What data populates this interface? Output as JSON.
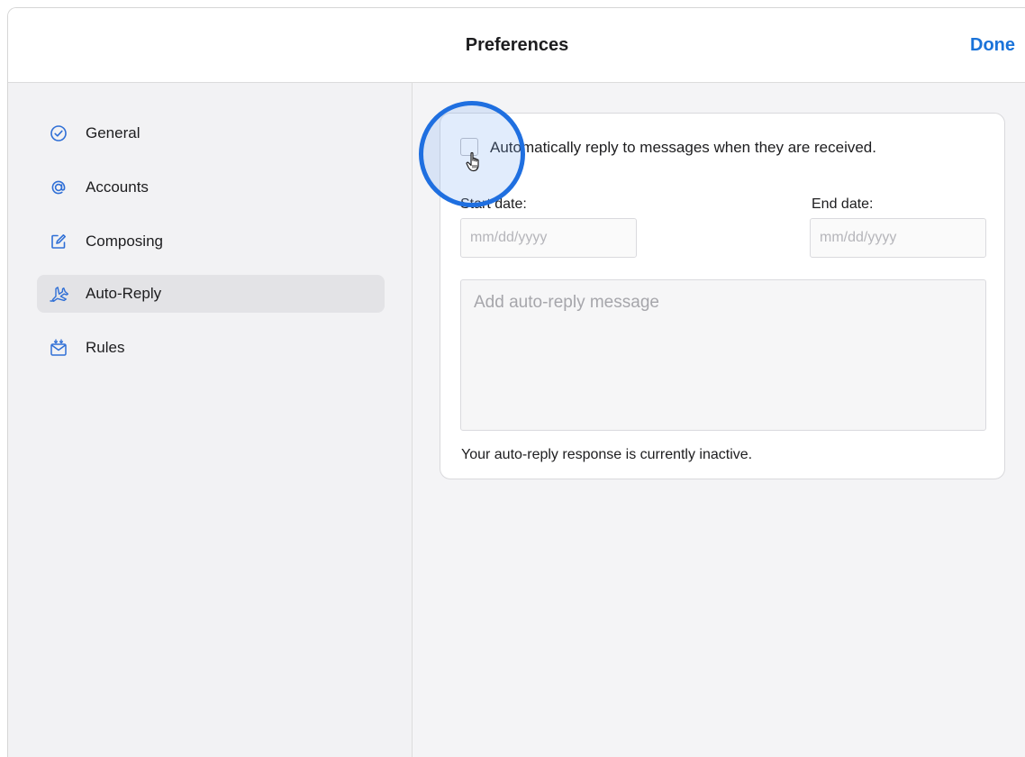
{
  "header": {
    "title": "Preferences",
    "done_label": "Done",
    "accent_color": "#1a73d9"
  },
  "sidebar": {
    "items": [
      {
        "label": "General",
        "icon": "checkmark-circle-icon",
        "active": false
      },
      {
        "label": "Accounts",
        "icon": "at-sign-icon",
        "active": false
      },
      {
        "label": "Composing",
        "icon": "compose-icon",
        "active": false
      },
      {
        "label": "Auto-Reply",
        "icon": "airplane-icon",
        "active": true
      },
      {
        "label": "Rules",
        "icon": "mail-rules-icon",
        "active": false
      }
    ]
  },
  "auto_reply": {
    "checkbox_label": "Automatically reply to messages when they are received.",
    "checkbox_checked": false,
    "start_date_label": "Start date:",
    "start_date_placeholder": "mm/dd/yyyy",
    "start_date_value": "",
    "end_date_label": "End date:",
    "end_date_placeholder": "mm/dd/yyyy",
    "end_date_value": "",
    "message_placeholder": "Add auto-reply message",
    "message_value": "",
    "status_text": "Your auto-reply response is currently inactive."
  },
  "colors": {
    "focus_ring": "#1f6fe0",
    "sidebar_icon": "#2f6fd6"
  }
}
